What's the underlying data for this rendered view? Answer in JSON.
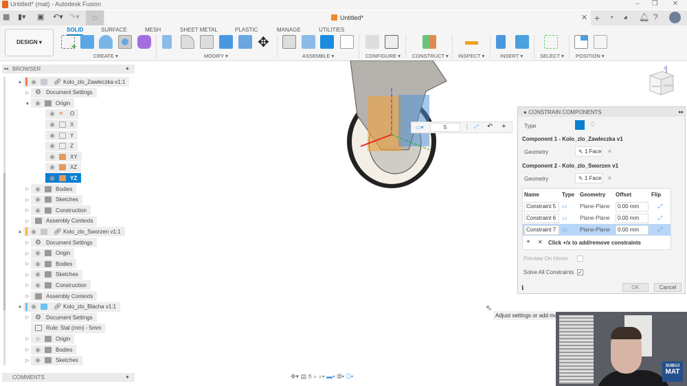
{
  "window": {
    "title": "Untitled* (mat) - Autodesk Fusion",
    "doc_tab": "Untitled*"
  },
  "ribbon": {
    "workspace": "DESIGN ▾",
    "tabs": [
      "SOLID",
      "SURFACE",
      "MESH",
      "SHEET METAL",
      "PLASTIC",
      "MANAGE",
      "UTILITIES"
    ],
    "active_tab": "SOLID",
    "groups": [
      "CREATE ▾",
      "MODIFY ▾",
      "ASSEMBLE ▾",
      "CONFIGURE ▾",
      "CONSTRUCT ▾",
      "INSPECT ▾",
      "INSERT ▾",
      "SELECT ▾",
      "POSITION ▾"
    ]
  },
  "browser": {
    "title": "BROWSER",
    "comments": "COMMENTS",
    "items": [
      {
        "label": "Kolo_zlo_Zawleczka v1:1",
        "level": 0,
        "arrow": "▲",
        "icon": "component",
        "eye": true,
        "link": true,
        "color": "#f07a4a"
      },
      {
        "label": "Document Settings",
        "level": 1,
        "arrow": "▷",
        "icon": "gear",
        "eye": false
      },
      {
        "label": "Origin",
        "level": 1,
        "arrow": "▲",
        "icon": "folder",
        "eye": true
      },
      {
        "label": "O",
        "level": 2,
        "icon": "point",
        "eye": true
      },
      {
        "label": "X",
        "level": 2,
        "icon": "axis",
        "eye": true
      },
      {
        "label": "Y",
        "level": 2,
        "icon": "axis",
        "eye": true
      },
      {
        "label": "Z",
        "level": 2,
        "icon": "axis",
        "eye": true
      },
      {
        "label": "XY",
        "level": 2,
        "icon": "plane",
        "eye": true
      },
      {
        "label": "XZ",
        "level": 2,
        "icon": "plane",
        "eye": true
      },
      {
        "label": "YZ",
        "level": 2,
        "icon": "plane",
        "eye": true,
        "selected": true
      },
      {
        "label": "Bodies",
        "level": 1,
        "arrow": "▷",
        "icon": "folder",
        "eye": true
      },
      {
        "label": "Sketches",
        "level": 1,
        "arrow": "▷",
        "icon": "folder",
        "eye": true
      },
      {
        "label": "Construction",
        "level": 1,
        "arrow": "▷",
        "icon": "folder",
        "eye": true
      },
      {
        "label": "Assembly Contexts",
        "level": 1,
        "arrow": "▷",
        "icon": "folder",
        "eye": false
      },
      {
        "label": "Kolo_zlo_Sworzen v1:1",
        "level": 0,
        "arrow": "▲",
        "icon": "component",
        "eye": true,
        "link": true,
        "color": "#f5b342"
      },
      {
        "label": "Document Settings",
        "level": 1,
        "arrow": "▷",
        "icon": "gear",
        "eye": false
      },
      {
        "label": "Origin",
        "level": 1,
        "arrow": "▷",
        "icon": "folder",
        "eye": true
      },
      {
        "label": "Bodies",
        "level": 1,
        "arrow": "▷",
        "icon": "folder",
        "eye": true
      },
      {
        "label": "Sketches",
        "level": 1,
        "arrow": "▷",
        "icon": "folder",
        "eye": true
      },
      {
        "label": "Construction",
        "level": 1,
        "arrow": "▷",
        "icon": "folder",
        "eye": true
      },
      {
        "label": "Assembly Contexts",
        "level": 1,
        "arrow": "▷",
        "icon": "folder",
        "eye": false
      },
      {
        "label": "Kolo_zlo_Blacha v1:1",
        "level": 0,
        "arrow": "▲",
        "icon": "sheetmetal",
        "eye": true,
        "link": true,
        "color": "#6ec1f0"
      },
      {
        "label": "Document Settings",
        "level": 1,
        "arrow": "▷",
        "icon": "gear",
        "eye": false
      },
      {
        "label": "Rule: Stal (mm) - 5mm",
        "level": 1,
        "icon": "rule",
        "eye": false
      },
      {
        "label": "Origin",
        "level": 1,
        "arrow": "▷",
        "icon": "folder",
        "eye": true,
        "hidden": true
      },
      {
        "label": "Bodies",
        "level": 1,
        "arrow": "▷",
        "icon": "folder",
        "eye": true
      },
      {
        "label": "Sketches",
        "level": 1,
        "arrow": "▷",
        "icon": "folder",
        "eye": true
      }
    ]
  },
  "viewcube": {
    "top": "TOP",
    "front": "FRONT",
    "right": "RIGHT",
    "axis": "Z"
  },
  "mini_toolbar": {
    "value": "5"
  },
  "dialog": {
    "title": "CONSTRAIN COMPONENTS",
    "type_label": "Type",
    "comp1": "Component 1 - Kolo_zlo_Zawleczka v1",
    "comp2": "Component 2 - Kolo_zlo_Sworzen v1",
    "geometry_label": "Geometry",
    "geom1": "1 Face",
    "geom2": "1 Face",
    "columns": [
      "Name",
      "Type",
      "Geometry",
      "Offset",
      "Flip"
    ],
    "rows": [
      {
        "name": "Constraint 5",
        "geometry": "Plane-Plane",
        "offset": "0.00 mm"
      },
      {
        "name": "Constraint 6",
        "geometry": "Plane-Plane",
        "offset": "0.00 mm"
      },
      {
        "name": "Constraint 7",
        "geometry": "Plane-Plane",
        "offset": "0.00 mm",
        "selected": true
      }
    ],
    "add_remove_hint": "Click +/x to add/remove constraints",
    "preview_on_hover": "Preview On Hover",
    "preview_checked": false,
    "solve_all": "Solve All Constraints",
    "solve_checked": true,
    "ok": "OK",
    "cancel": "Cancel",
    "accent": "#0a7fd1"
  },
  "tooltip": "Adjust settings or add mo",
  "webcam": {
    "logo_top": "SUBUJ",
    "logo_bottom": "MAT"
  }
}
